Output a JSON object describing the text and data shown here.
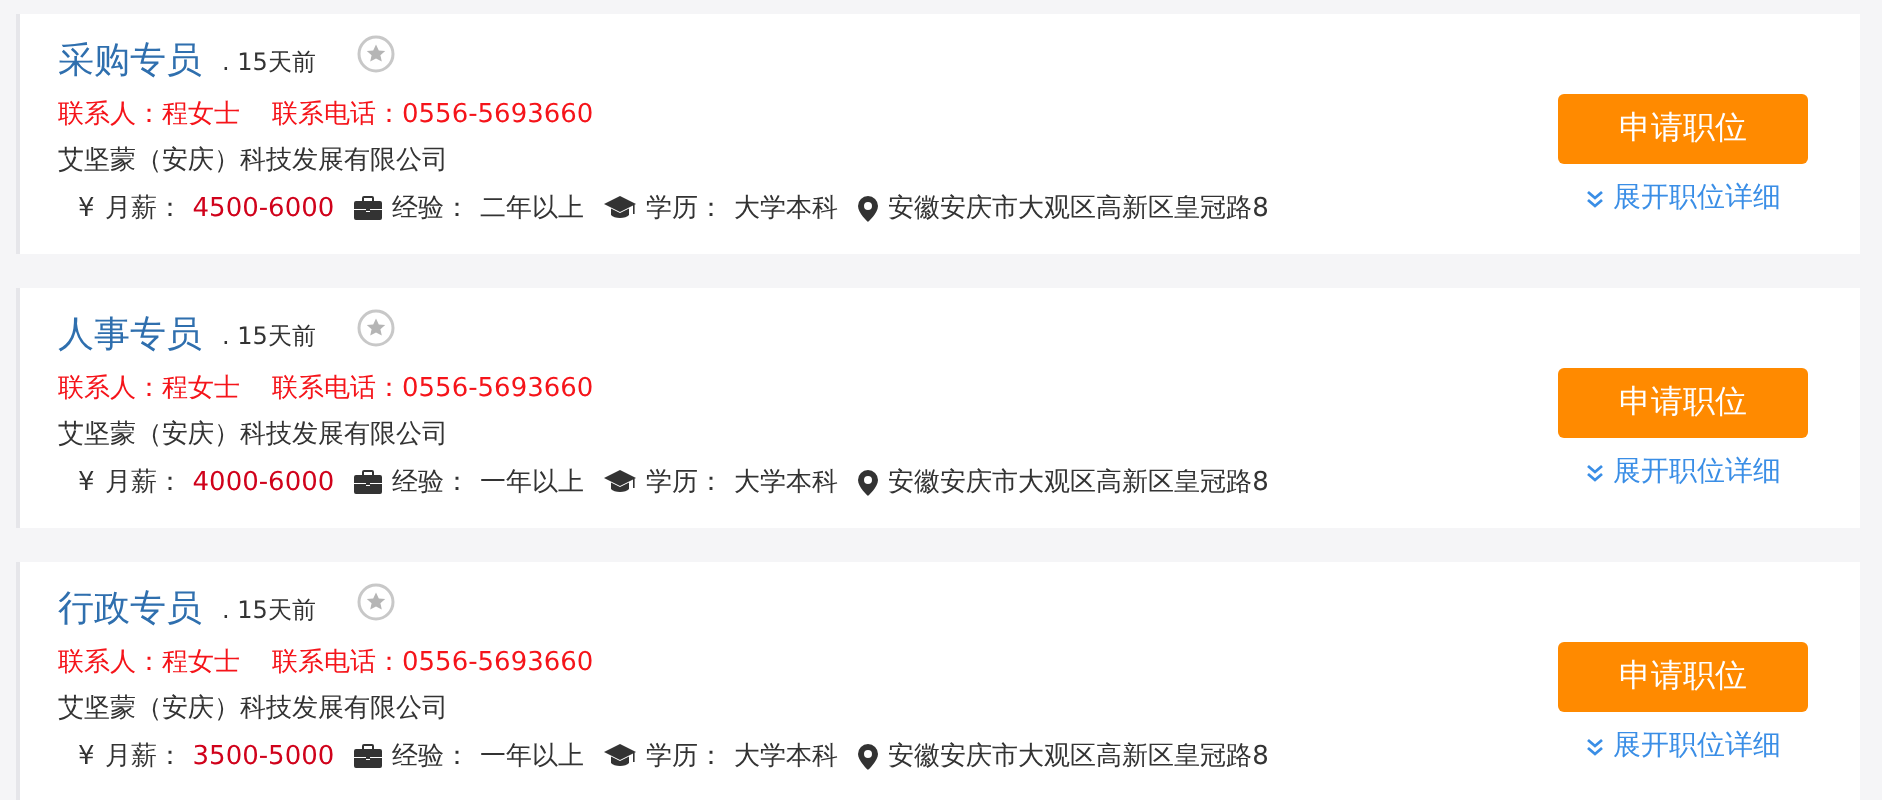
{
  "jobs": [
    {
      "title": "采购专员",
      "posted": ". 15天前",
      "contact": "联系人：程女士",
      "phone": "联系电话：0556-5693660",
      "company": "艾坚蒙（安庆）科技发展有限公司",
      "currency": "¥",
      "salary_label": "月薪：",
      "salary": "4500-6000",
      "experience_label": "经验：",
      "experience": "二年以上",
      "education_label": "学历：",
      "education": "大学本科",
      "location": "安徽安庆市大观区高新区皇冠路8",
      "apply": "申请职位",
      "expand": "展开职位详细"
    },
    {
      "title": "人事专员",
      "posted": ". 15天前",
      "contact": "联系人：程女士",
      "phone": "联系电话：0556-5693660",
      "company": "艾坚蒙（安庆）科技发展有限公司",
      "currency": "¥",
      "salary_label": "月薪：",
      "salary": "4000-6000",
      "experience_label": "经验：",
      "experience": "一年以上",
      "education_label": "学历：",
      "education": "大学本科",
      "location": "安徽安庆市大观区高新区皇冠路8",
      "apply": "申请职位",
      "expand": "展开职位详细"
    },
    {
      "title": "行政专员",
      "posted": ". 15天前",
      "contact": "联系人：程女士",
      "phone": "联系电话：0556-5693660",
      "company": "艾坚蒙（安庆）科技发展有限公司",
      "currency": "¥",
      "salary_label": "月薪：",
      "salary": "3500-5000",
      "experience_label": "经验：",
      "experience": "一年以上",
      "education_label": "学历：",
      "education": "大学本科",
      "location": "安徽安庆市大观区高新区皇冠路8",
      "apply": "申请职位",
      "expand": "展开职位详细"
    }
  ]
}
